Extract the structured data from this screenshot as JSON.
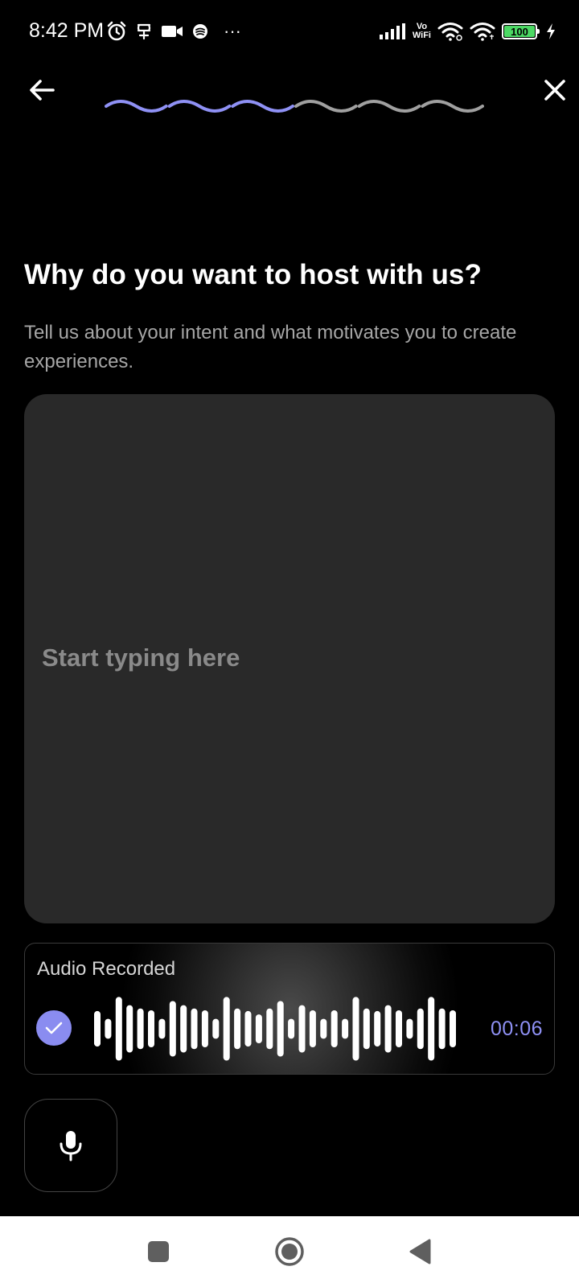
{
  "status_bar": {
    "time": "8:42 PM",
    "battery_level": "100",
    "vowifi_top": "Vo",
    "vowifi_bottom": "WiFi",
    "overflow": "···",
    "icons": [
      "alarm-icon",
      "notification-icon",
      "video-camera-icon",
      "app-icon",
      "overflow-dots-icon",
      "signal-icon",
      "vowifi-icon",
      "wifi-icon",
      "wifi-icon",
      "battery-icon",
      "charging-icon"
    ]
  },
  "header": {
    "back_icon": "arrow-left-icon",
    "close_icon": "close-icon",
    "progress": {
      "completed_steps": 3,
      "total_steps": 6,
      "active_color": "#8f91f5",
      "inactive_color": "#a0a0a0"
    }
  },
  "main": {
    "title": "Why do you want to host with us?",
    "subtitle": "Tell us about your intent and what motivates you to create experiences.",
    "text_input": {
      "placeholder": "Start typing here",
      "value": ""
    }
  },
  "audio": {
    "label": "Audio Recorded",
    "duration": "00:06",
    "status_icon": "checkmark-icon",
    "waveform_levels": [
      0.48,
      0.27,
      0.86,
      0.64,
      0.55,
      0.5,
      0.27,
      0.75,
      0.64,
      0.55,
      0.5,
      0.27,
      0.86,
      0.55,
      0.48,
      0.39,
      0.55,
      0.75,
      0.27,
      0.64,
      0.5,
      0.27,
      0.5,
      0.27,
      0.86,
      0.55,
      0.48,
      0.64,
      0.5,
      0.27,
      0.55,
      0.86,
      0.55,
      0.5
    ],
    "accent_color": "#8a8cf0"
  },
  "mic_button": {
    "icon": "microphone-icon"
  },
  "nav_bar": {
    "items": [
      "square-recents-icon",
      "circle-home-icon",
      "triangle-back-icon"
    ]
  }
}
